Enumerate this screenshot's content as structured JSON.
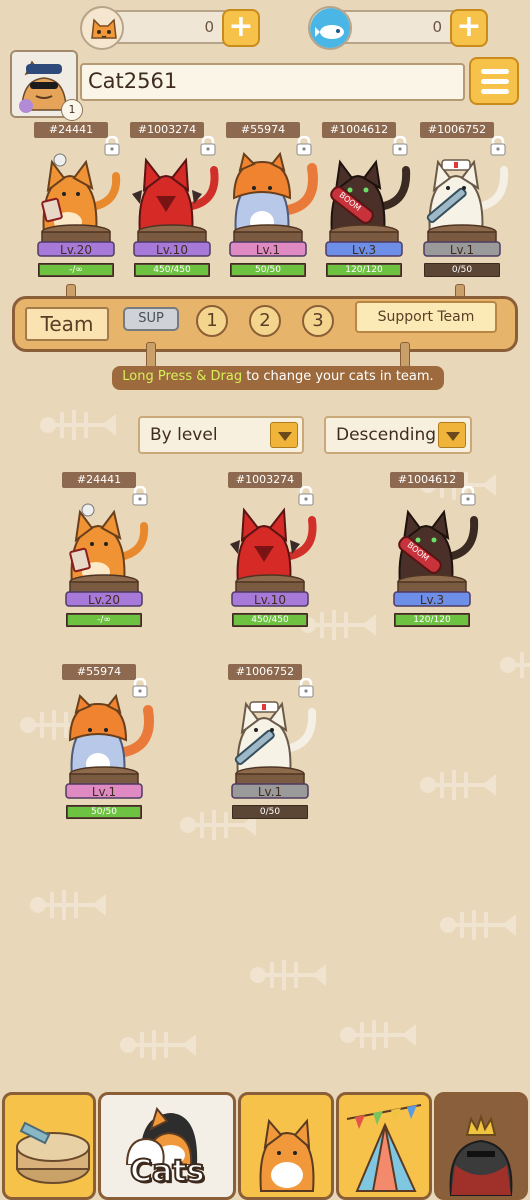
{
  "currency": {
    "coins": "0",
    "fish": "0",
    "plus_symbol": "+"
  },
  "profile": {
    "name": "Cat2561",
    "level": "1"
  },
  "team_slots": [
    {
      "id": "#24441",
      "level": "Lv.20",
      "hp": "-/∞",
      "hp_fill": 1.0,
      "pedestal_color": "#a77ad9",
      "cat": "orange-gambler-cat-icon"
    },
    {
      "id": "#1003274",
      "level": "Lv.10",
      "hp": "450/450",
      "hp_fill": 1.0,
      "pedestal_color": "#a77ad9",
      "cat": "red-devil-cat-icon"
    },
    {
      "id": "#55974",
      "level": "Lv.1",
      "hp": "50/50",
      "hp_fill": 1.0,
      "pedestal_color": "#e08ac4",
      "cat": "blue-hooded-cat-icon"
    },
    {
      "id": "#1004612",
      "level": "Lv.3",
      "hp": "120/120",
      "hp_fill": 1.0,
      "pedestal_color": "#6e8fe8",
      "cat": "dark-rocket-cat-icon"
    },
    {
      "id": "#1006752",
      "level": "Lv.1",
      "hp": "0/50",
      "hp_fill": 0.0,
      "pedestal_color": "#9a9a9a",
      "cat": "nurse-syringe-cat-icon"
    }
  ],
  "team_bar": {
    "label": "Team",
    "sup": "SUP",
    "numbers": [
      "1",
      "2",
      "3"
    ],
    "support": "Support Team",
    "hint_highlight": "Long Press & Drag",
    "hint_rest": " to change your cats in team."
  },
  "sort": {
    "by": "By level",
    "order": "Descending"
  },
  "collection": [
    {
      "id": "#24441",
      "level": "Lv.20",
      "hp": "-/∞",
      "hp_fill": 1.0,
      "pedestal_color": "#a77ad9",
      "cat": "orange-gambler-cat-icon"
    },
    {
      "id": "#1003274",
      "level": "Lv.10",
      "hp": "450/450",
      "hp_fill": 1.0,
      "pedestal_color": "#a77ad9",
      "cat": "red-devil-cat-icon"
    },
    {
      "id": "#1004612",
      "level": "Lv.3",
      "hp": "120/120",
      "hp_fill": 1.0,
      "pedestal_color": "#6e8fe8",
      "cat": "dark-rocket-cat-icon"
    },
    {
      "id": "#55974",
      "level": "Lv.1",
      "hp": "50/50",
      "hp_fill": 1.0,
      "pedestal_color": "#e08ac4",
      "cat": "blue-hooded-cat-icon"
    },
    {
      "id": "#1006752",
      "level": "Lv.1",
      "hp": "0/50",
      "hp_fill": 0.0,
      "pedestal_color": "#9a9a9a",
      "cat": "nurse-syringe-cat-icon"
    }
  ],
  "nav": {
    "tabs": [
      {
        "name": "food-tab",
        "icon": "cat-food-can-icon"
      },
      {
        "name": "cats-tab",
        "icon": "cat-group-icon",
        "label": "Cats",
        "active": true
      },
      {
        "name": "cat-tab",
        "icon": "orange-cat-icon"
      },
      {
        "name": "decor-tab",
        "icon": "tent-flags-icon"
      },
      {
        "name": "boss-tab",
        "icon": "crowned-boss-icon"
      }
    ]
  }
}
